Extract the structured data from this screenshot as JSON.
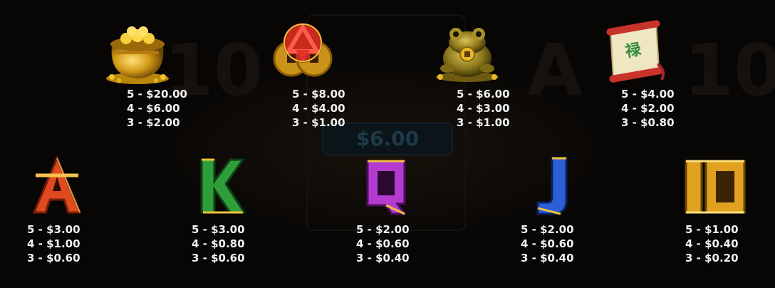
{
  "symbols": [
    {
      "id": "pot",
      "icon": "gold-pot-icon",
      "payouts": [
        "5 - $20.00",
        "4 - $6.00",
        "3 - $2.00"
      ]
    },
    {
      "id": "coins",
      "icon": "coins-knot-icon",
      "payouts": [
        "5 - $8.00",
        "4 - $4.00",
        "3 - $1.00"
      ]
    },
    {
      "id": "toad",
      "icon": "money-toad-icon",
      "payouts": [
        "5 - $6.00",
        "4 - $3.00",
        "3 - $1.00"
      ]
    },
    {
      "id": "scroll",
      "icon": "scroll-icon",
      "payouts": [
        "5 - $4.00",
        "4 - $2.00",
        "3 - $0.80"
      ]
    },
    {
      "id": "ace",
      "icon": "ace-letter-icon",
      "label": "A",
      "color": "#e04a1e",
      "payouts": [
        "5 - $3.00",
        "4 - $1.00",
        "3 - $0.60"
      ]
    },
    {
      "id": "king",
      "icon": "king-letter-icon",
      "label": "K",
      "color": "#2f9e3a",
      "payouts": [
        "5 - $3.00",
        "4 - $0.80",
        "3 - $0.60"
      ]
    },
    {
      "id": "queen",
      "icon": "queen-letter-icon",
      "label": "Q",
      "color": "#b43bd0",
      "payouts": [
        "5 - $2.00",
        "4 - $0.60",
        "3 - $0.40"
      ]
    },
    {
      "id": "jack",
      "icon": "jack-letter-icon",
      "label": "J",
      "color": "#2c5fd6",
      "payouts": [
        "5 - $2.00",
        "4 - $0.60",
        "3 - $0.40"
      ]
    },
    {
      "id": "ten",
      "icon": "ten-letter-icon",
      "label": "10",
      "color": "#e0a21e",
      "payouts": [
        "5 - $1.00",
        "4 - $0.40",
        "3 - $0.20"
      ]
    }
  ],
  "background_amount": "$6.00",
  "colors": {
    "text": "#f2f2f2",
    "gold": "#d4a017",
    "background": "#070605"
  }
}
